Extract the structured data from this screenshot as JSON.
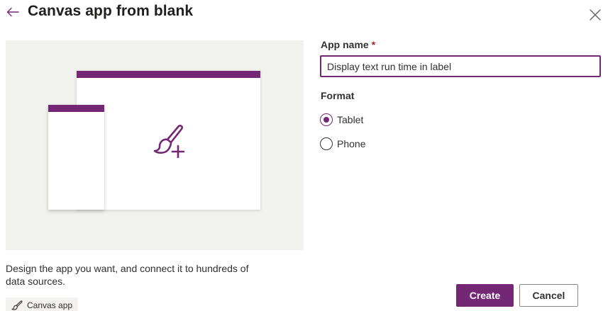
{
  "header": {
    "title": "Canvas app from blank",
    "back_icon": "arrow-left-icon",
    "close_icon": "close-icon"
  },
  "illustration": {
    "accent_color": "#742774",
    "icon": "paintbrush-add-icon"
  },
  "description": "Design the app you want, and connect it to hundreds of data sources.",
  "tag": {
    "icon": "paintbrush-icon",
    "label": "Canvas app"
  },
  "form": {
    "app_name": {
      "label": "App name",
      "required_marker": "*",
      "value": "Display text run time in label"
    },
    "format": {
      "label": "Format",
      "options": [
        {
          "label": "Tablet",
          "selected": true
        },
        {
          "label": "Phone",
          "selected": false
        }
      ]
    }
  },
  "buttons": {
    "create": "Create",
    "cancel": "Cancel"
  }
}
